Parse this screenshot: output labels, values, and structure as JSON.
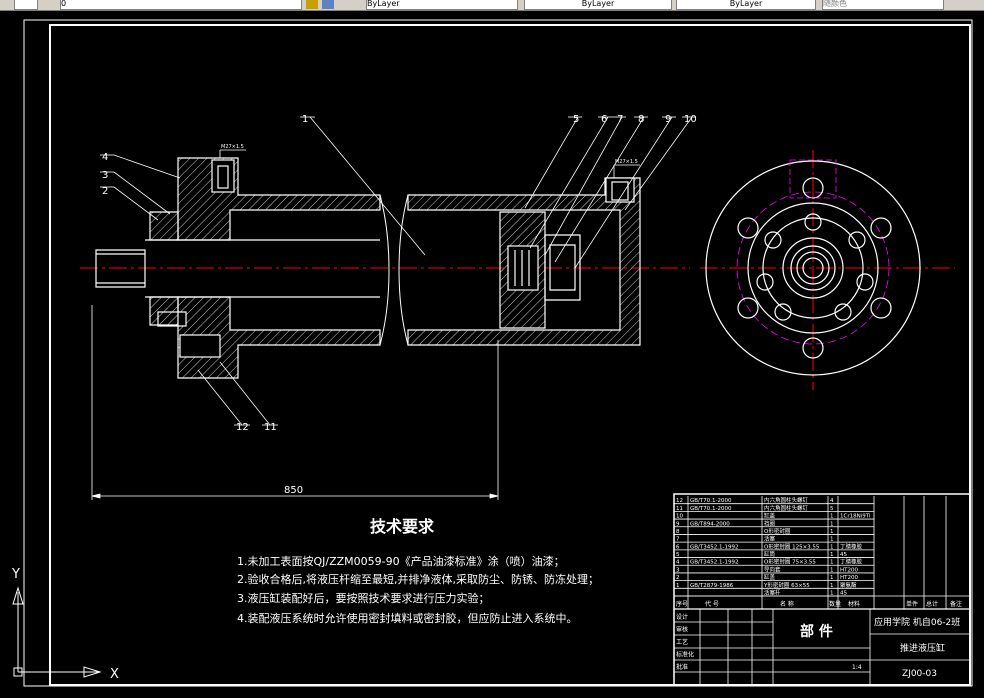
{
  "toolbar": {
    "layer_value": "0",
    "color_value": "ByLayer",
    "linetype_value": "ByLayer",
    "lineweight_value": "ByLayer",
    "plotstyle_value": "随颜色"
  },
  "drawing": {
    "balloons": [
      "1",
      "2",
      "3",
      "4",
      "5",
      "6",
      "7",
      "8",
      "9",
      "10",
      "11",
      "12"
    ],
    "dimension": "850",
    "port_label_1": "M27×1.5",
    "port_label_2": "M27×1.5",
    "tech_title": "技术要求",
    "tech_notes": [
      "1.未加工表面按QJ/ZZM0059-90《产品油漆标准》涂（喷）油漆；",
      "2.验收合格后,将液压杆缩至最短,并排净液体,采取防尘、防锈、防冻处理；",
      "3.液压缸装配好后，要按照技术要求进行压力实验；",
      "4.装配液压系统时允许使用密封填料或密封胶，但应防止进入系统中。"
    ]
  },
  "title_block": {
    "parts_title": "部 件",
    "school": "应用学院 机自06-2班",
    "drawing_name": "推进液压缸",
    "drawing_no": "ZJ00-03",
    "scale": "1:4",
    "header_cols": [
      "序号",
      "代 号",
      "名 称",
      "数量",
      "材料",
      "单件",
      "总计",
      "备注"
    ],
    "rows": [
      {
        "no": "12",
        "code": "GB/T70.1-2000",
        "name": "内六角圆柱头螺钉",
        "qty": "4",
        "mat": ""
      },
      {
        "no": "11",
        "code": "GB/T70.1-2000",
        "name": "内六角圆柱头螺钉",
        "qty": "5",
        "mat": ""
      },
      {
        "no": "10",
        "code": "",
        "name": "缸盖",
        "qty": "1",
        "mat": "1Cr18Ni9Ti"
      },
      {
        "no": "9",
        "code": "GB/T894-2000",
        "name": "挡圈",
        "qty": "1",
        "mat": ""
      },
      {
        "no": "8",
        "code": "",
        "name": "O形密封圈",
        "qty": "1",
        "mat": ""
      },
      {
        "no": "7",
        "code": "",
        "name": "活塞",
        "qty": "1",
        "mat": ""
      },
      {
        "no": "6",
        "code": "GB/T3452.1-1992",
        "name": "O形密封圈 125×3.55",
        "qty": "1",
        "mat": "丁腈橡胶"
      },
      {
        "no": "5",
        "code": "",
        "name": "缸筒",
        "qty": "1",
        "mat": "45"
      },
      {
        "no": "4",
        "code": "GB/T3452.1-1992",
        "name": "O形密封圈 75×3.55",
        "qty": "1",
        "mat": "丁腈橡胶"
      },
      {
        "no": "3",
        "code": "",
        "name": "导向套",
        "qty": "1",
        "mat": "HT200"
      },
      {
        "no": "2",
        "code": "",
        "name": "缸盖",
        "qty": "1",
        "mat": "HT200"
      },
      {
        "no": "1",
        "code": "GB/T2879-1986",
        "name": "Y形密封圈 63×55",
        "qty": "1",
        "mat": "聚氨酯"
      },
      {
        "no": "",
        "code": "",
        "name": "活塞杆",
        "qty": "1",
        "mat": "45"
      }
    ],
    "sign_labels": [
      "设计",
      "审核",
      "工艺",
      "标准化",
      "批准"
    ]
  },
  "ucs": {
    "x_label": "X",
    "y_label": "Y"
  },
  "colors": {
    "line": "#ffffff",
    "center": "#ff0000",
    "hatch": "#ffffff",
    "dash": "#ff00ff",
    "balloon": "#ffffff"
  }
}
